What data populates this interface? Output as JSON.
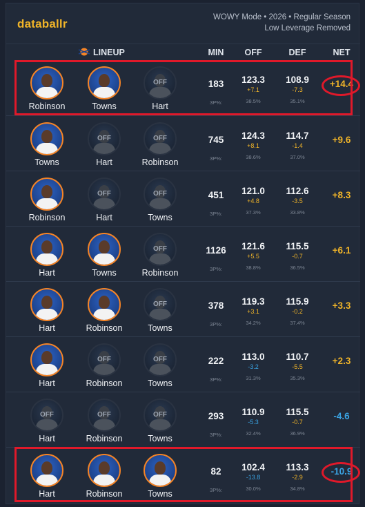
{
  "brand": "databallr",
  "mode_line1": "WOWY Mode • 2026 • Regular Season",
  "mode_line2": "Low Leverage Removed",
  "headers": {
    "lineup": "LINEUP",
    "min": "MIN",
    "off": "OFF",
    "def": "DEF",
    "net": "NET"
  },
  "off_label": "OFF",
  "three_label": "3P%:",
  "colors": {
    "brand": "#f0b429",
    "positive": "#f0b429",
    "negative": "#3aa3e3",
    "highlight": "#e0192a",
    "avatar_ring": "#f58426"
  },
  "chart_data": {
    "type": "table",
    "columns": [
      "LINEUP",
      "MIN",
      "OFF",
      "DEF",
      "NET"
    ],
    "rows": [
      {
        "players": [
          {
            "name": "Robinson",
            "on": true
          },
          {
            "name": "Towns",
            "on": true
          },
          {
            "name": "Hart",
            "on": false
          }
        ],
        "min": "183",
        "off": "123.3",
        "off_delta": "+7.1",
        "off_3p": "38.5%",
        "def": "108.9",
        "def_delta": "-7.3",
        "def_3p": "35.1%",
        "net": "+14.4",
        "highlight": true
      },
      {
        "players": [
          {
            "name": "Towns",
            "on": true
          },
          {
            "name": "Hart",
            "on": false
          },
          {
            "name": "Robinson",
            "on": false
          }
        ],
        "min": "745",
        "off": "124.3",
        "off_delta": "+8.1",
        "off_3p": "38.6%",
        "def": "114.7",
        "def_delta": "-1.4",
        "def_3p": "37.0%",
        "net": "+9.6",
        "highlight": false
      },
      {
        "players": [
          {
            "name": "Robinson",
            "on": true
          },
          {
            "name": "Hart",
            "on": false
          },
          {
            "name": "Towns",
            "on": false
          }
        ],
        "min": "451",
        "off": "121.0",
        "off_delta": "+4.8",
        "off_3p": "37.3%",
        "def": "112.6",
        "def_delta": "-3.5",
        "def_3p": "33.8%",
        "net": "+8.3",
        "highlight": false
      },
      {
        "players": [
          {
            "name": "Hart",
            "on": true
          },
          {
            "name": "Towns",
            "on": true
          },
          {
            "name": "Robinson",
            "on": false
          }
        ],
        "min": "1126",
        "off": "121.6",
        "off_delta": "+5.5",
        "off_3p": "38.8%",
        "def": "115.5",
        "def_delta": "-0.7",
        "def_3p": "36.5%",
        "net": "+6.1",
        "highlight": false
      },
      {
        "players": [
          {
            "name": "Hart",
            "on": true
          },
          {
            "name": "Robinson",
            "on": true
          },
          {
            "name": "Towns",
            "on": false
          }
        ],
        "min": "378",
        "off": "119.3",
        "off_delta": "+3.1",
        "off_3p": "34.2%",
        "def": "115.9",
        "def_delta": "-0.2",
        "def_3p": "37.4%",
        "net": "+3.3",
        "highlight": false
      },
      {
        "players": [
          {
            "name": "Hart",
            "on": true
          },
          {
            "name": "Robinson",
            "on": false
          },
          {
            "name": "Towns",
            "on": false
          }
        ],
        "min": "222",
        "off": "113.0",
        "off_delta": "-3.2",
        "off_3p": "31.3%",
        "def": "110.7",
        "def_delta": "-5.5",
        "def_3p": "35.3%",
        "net": "+2.3",
        "highlight": false
      },
      {
        "players": [
          {
            "name": "Hart",
            "on": false
          },
          {
            "name": "Robinson",
            "on": false
          },
          {
            "name": "Towns",
            "on": false
          }
        ],
        "min": "293",
        "off": "110.9",
        "off_delta": "-5.3",
        "off_3p": "32.4%",
        "def": "115.5",
        "def_delta": "-0.7",
        "def_3p": "36.9%",
        "net": "-4.6",
        "highlight": false
      },
      {
        "players": [
          {
            "name": "Hart",
            "on": true
          },
          {
            "name": "Robinson",
            "on": true
          },
          {
            "name": "Towns",
            "on": true
          }
        ],
        "min": "82",
        "off": "102.4",
        "off_delta": "-13.8",
        "off_3p": "30.0%",
        "def": "113.3",
        "def_delta": "-2.9",
        "def_3p": "34.8%",
        "net": "-10.9",
        "highlight": true
      }
    ]
  }
}
